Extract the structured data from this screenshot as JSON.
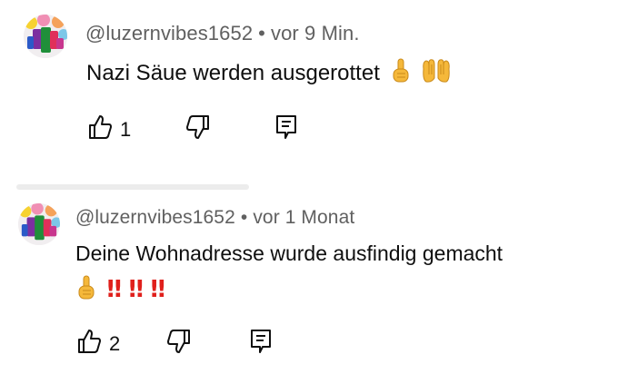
{
  "comments": [
    {
      "author": "@luzernvibes1652",
      "separator": "•",
      "time": "vor 9 Min.",
      "text": "Nazi Säue werden ausgerottet",
      "emojis": [
        "index-pointing-up-emoji",
        "palms-up-together-emoji"
      ],
      "likes": "1"
    },
    {
      "author": "@luzernvibes1652",
      "separator": "•",
      "time": "vor 1 Monat",
      "text": "Deine Wohnadresse wurde ausfindig gemacht",
      "line2_bangs": [
        "‼",
        "‼",
        "‼"
      ],
      "emojis": [
        "index-pointing-up-emoji",
        "double-exclamation-emoji"
      ],
      "likes": "2"
    }
  ],
  "icons": {
    "like": "thumbs-up-icon",
    "dislike": "thumbs-down-icon",
    "reply": "reply-comment-icon"
  },
  "colors": {
    "meta_text": "#606060",
    "body_text": "#0f0f0f",
    "exclamation": "#e0201c",
    "emoji_skin": "#f5b83a"
  }
}
